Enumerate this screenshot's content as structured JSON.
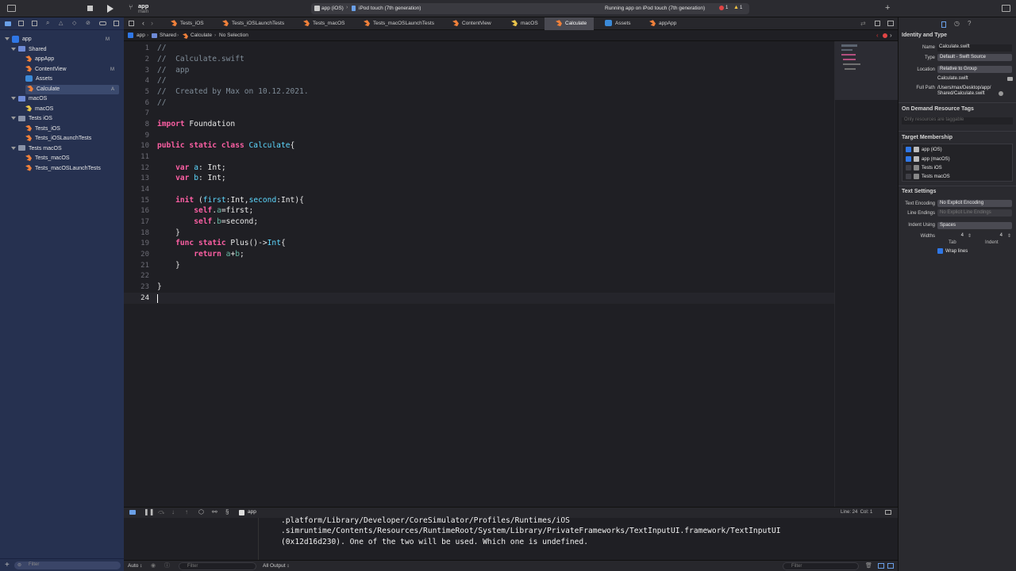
{
  "toolbar": {
    "project_name": "app",
    "branch": "main",
    "scheme": "app (iOS)",
    "device": "iPod touch (7th generation)",
    "status": "Running app on iPod touch (7th generation)",
    "errors": "1",
    "warnings": "1"
  },
  "navigator": {
    "items": [
      {
        "label": "app",
        "badge": "M"
      },
      {
        "label": "Shared",
        "badge": ""
      },
      {
        "label": "appApp",
        "badge": ""
      },
      {
        "label": "ContentView",
        "badge": "M"
      },
      {
        "label": "Assets",
        "badge": ""
      },
      {
        "label": "Calculate",
        "badge": "A"
      },
      {
        "label": "macOS",
        "badge": ""
      },
      {
        "label": "macOS",
        "badge": ""
      },
      {
        "label": "Tests iOS",
        "badge": ""
      },
      {
        "label": "Tests_iOS",
        "badge": ""
      },
      {
        "label": "Tests_iOSLaunchTests",
        "badge": ""
      },
      {
        "label": "Tests macOS",
        "badge": ""
      },
      {
        "label": "Tests_macOS",
        "badge": ""
      },
      {
        "label": "Tests_macOSLaunchTests",
        "badge": ""
      }
    ],
    "filter_placeholder": "Filter"
  },
  "tabs": [
    "Tests_iOS",
    "Tests_iOSLaunchTests",
    "Tests_macOS",
    "Tests_macOSLaunchTests",
    "ContentView",
    "macOS",
    "Calculate",
    "Assets",
    "appApp"
  ],
  "jumpbar": [
    "app",
    "Shared",
    "Calculate",
    "No Selection"
  ],
  "editor": {
    "line_numbers": [
      "1",
      "2",
      "3",
      "4",
      "5",
      "6",
      "7",
      "8",
      "9",
      "10",
      "11",
      "12",
      "13",
      "14",
      "15",
      "16",
      "17",
      "18",
      "19",
      "20",
      "21",
      "22",
      "23",
      "24"
    ]
  },
  "inspector": {
    "identity_header": "Identity and Type",
    "name_label": "Name",
    "name_value": "Calculate.swift",
    "type_label": "Type",
    "type_value": "Default - Swift Source",
    "location_label": "Location",
    "location_value": "Relative to Group",
    "location_file": "Calculate.swift",
    "fullpath_label": "Full Path",
    "fullpath_line1": "/Users/max/Desktop/app/",
    "fullpath_line2": "Shared/Calculate.swift",
    "odr_header": "On Demand Resource Tags",
    "odr_placeholder": "Only resources are taggable",
    "target_header": "Target Membership",
    "targets": [
      {
        "label": "app (iOS)",
        "checked": true
      },
      {
        "label": "app (macOS)",
        "checked": true
      },
      {
        "label": "Tests iOS",
        "checked": false
      },
      {
        "label": "Tests macOS",
        "checked": false
      }
    ],
    "text_header": "Text Settings",
    "encoding_label": "Text Encoding",
    "encoding_value": "No Explicit Encoding",
    "endings_label": "Line Endings",
    "endings_value": "No Explicit Line Endings",
    "indent_label": "Indent Using",
    "indent_value": "Spaces",
    "widths_label": "Widths",
    "tab_width": "4",
    "indent_width": "4",
    "tab_caption": "Tab",
    "indent_caption": "Indent",
    "wrap_label": "Wrap lines"
  },
  "debug": {
    "target": "app",
    "position": "Line: 24  Col: 1",
    "console_lines": [
      ".platform/Library/Developer/CoreSimulator/Profiles/Runtimes/iOS",
      ".simruntime/Contents/Resources/RuntimeRoot/System/Library/PrivateFrameworks/TextInputUI.framework/TextInputUI",
      "(0x12d16d230). One of the two will be used. Which one is undefined."
    ],
    "auto_label": "Auto ↕",
    "filter_placeholder": "Filter",
    "output_label": "All Output ↕"
  }
}
